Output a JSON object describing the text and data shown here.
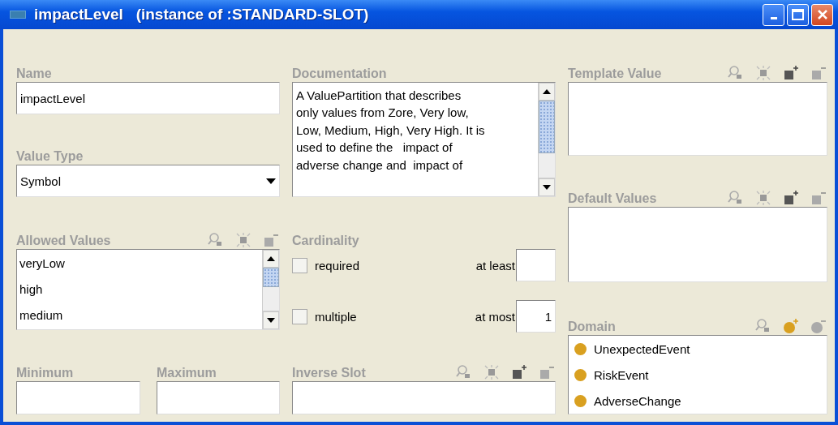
{
  "window": {
    "title": "impactLevel   (instance of :STANDARD-SLOT)"
  },
  "name": {
    "label": "Name",
    "value": "impactLevel"
  },
  "value_type": {
    "label": "Value Type",
    "value": "Symbol"
  },
  "allowed_values": {
    "label": "Allowed Values",
    "tools": [
      {
        "kind": "find"
      },
      {
        "kind": "view"
      },
      {
        "kind": "remove"
      }
    ],
    "items": [
      "veryLow",
      "high",
      "medium"
    ]
  },
  "minimum": {
    "label": "Minimum"
  },
  "maximum": {
    "label": "Maximum"
  },
  "documentation": {
    "label": "Documentation",
    "value": "A ValuePartition that describes\nonly values from Zore, Very low,\nLow, Medium, High, Very High. It is\nused to define the   impact of\nadverse change and  impact of"
  },
  "cardinality": {
    "label": "Cardinality",
    "rows": [
      {
        "label": "required",
        "checked": false,
        "bound_label": "at least"
      },
      {
        "label": "multiple",
        "checked": false,
        "bound_label": "at most",
        "bound_value": "1"
      }
    ]
  },
  "inverse_slot": {
    "label": "Inverse Slot",
    "tools": [
      {
        "kind": "find"
      },
      {
        "kind": "view"
      },
      {
        "kind": "add"
      },
      {
        "kind": "remove"
      }
    ]
  },
  "template_value": {
    "label": "Template Value",
    "tools": [
      {
        "kind": "find"
      },
      {
        "kind": "view"
      },
      {
        "kind": "add"
      },
      {
        "kind": "remove"
      }
    ]
  },
  "default_values": {
    "label": "Default Values",
    "tools": [
      {
        "kind": "find"
      },
      {
        "kind": "view"
      },
      {
        "kind": "add"
      },
      {
        "kind": "remove"
      }
    ]
  },
  "domain": {
    "label": "Domain",
    "tools": [
      {
        "kind": "find"
      },
      {
        "kind": "add_class"
      },
      {
        "kind": "remove_class"
      }
    ],
    "items": [
      {
        "name": "UnexpectedEvent",
        "color": "#d9a020"
      },
      {
        "name": "RiskEvent",
        "color": "#d9a020"
      },
      {
        "name": "AdverseChange",
        "color": "#d9a020"
      }
    ]
  }
}
